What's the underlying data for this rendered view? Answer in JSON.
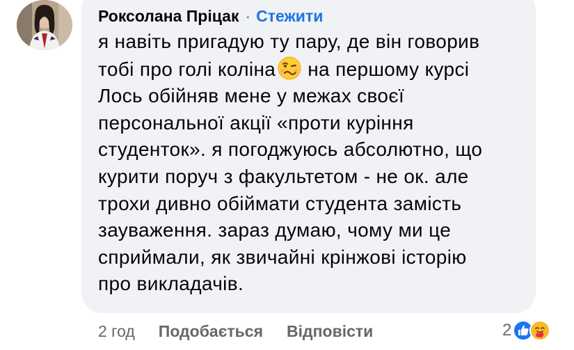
{
  "comment": {
    "author": "Роксолана Пріцак",
    "separator": "·",
    "follow_label": "Стежити",
    "lines": [
      "я навіть пригадую ту пару, де він говорив",
      "тобі про голі коліна",
      "на першому курсі",
      "Лось обійняв мене у межах своєї",
      "персональної акції «проти куріння",
      "студенток». я погоджуюсь абсолютно, що",
      "курити поруч з факультетом - не ок. але",
      "трохи дивно обіймати студента замість",
      "зауваження. зараз думаю, чому ми це",
      "сприймали, як звичайні крінжові історію",
      "про викладачів."
    ],
    "inline_emoji": "woozy-face-emoji"
  },
  "actions": {
    "time": "2 год",
    "like_label": "Подобається",
    "reply_label": "Відповісти"
  },
  "reactions": {
    "count": "2",
    "icons": [
      "like-reaction-icon",
      "care-reaction-icon"
    ]
  },
  "colors": {
    "bubble": "#f0f2f5",
    "text": "#050505",
    "secondary": "#65676b",
    "accent": "#1b74e4",
    "like_blue": "#1877f2",
    "care_yellow": "#f7b928"
  }
}
